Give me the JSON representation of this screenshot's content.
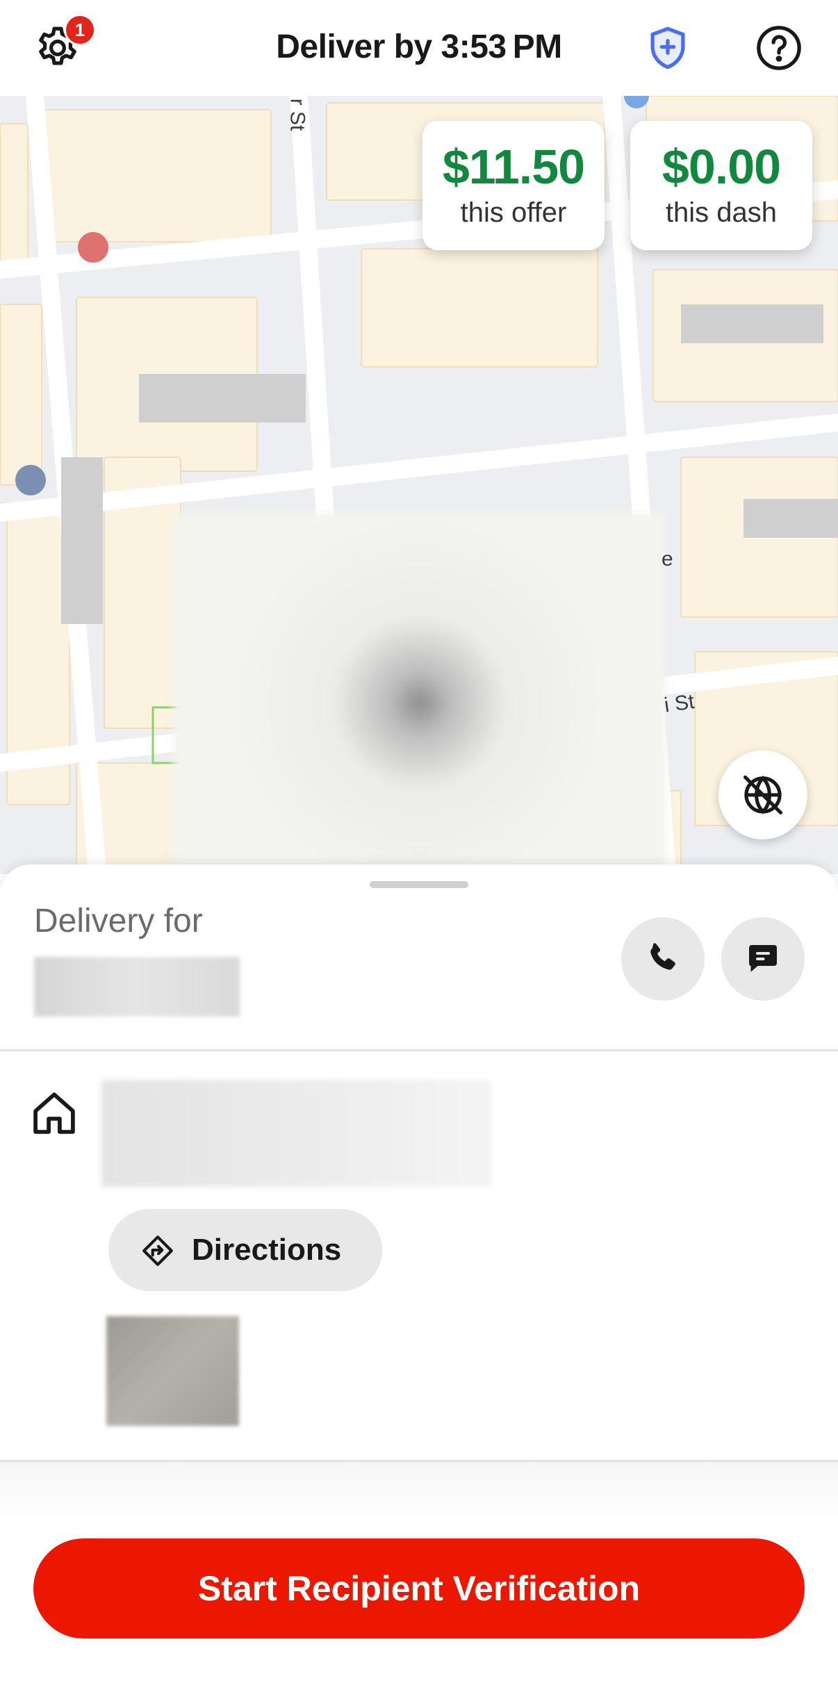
{
  "header": {
    "title": "Deliver by 3:53 PM",
    "settings_badge": "1",
    "icons": [
      "gear-icon",
      "shield-plus-icon",
      "help-icon"
    ],
    "shield_color": "#4a6cf7"
  },
  "map": {
    "streets": [
      "r St",
      "i St",
      "e"
    ],
    "earnings": {
      "offer_amount": "$11.50",
      "offer_label": "this offer",
      "dash_amount": "$0.00",
      "dash_label": "this dash"
    },
    "earnings_color": "#12883f"
  },
  "sheet": {
    "delivery_for_label": "Delivery for",
    "directions_label": "Directions",
    "primary_action": "Start Recipient Verification",
    "primary_color": "#eb1700"
  }
}
